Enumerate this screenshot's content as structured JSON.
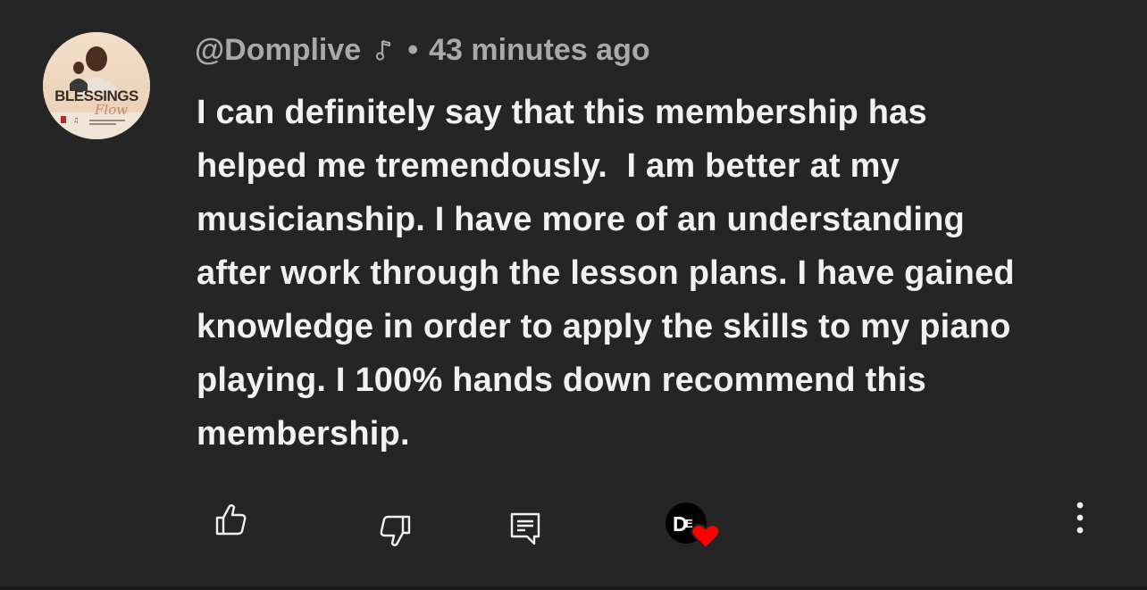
{
  "comment": {
    "author": "@Domplive",
    "separator": "•",
    "timestamp": "43 minutes ago",
    "text": "I can definitely say that this membership has\nhelped me tremendously.  I am better at my\nmusicianship. I have more of an understanding\nafter work through the lesson plans. I have gained\nknowledge in order to apply the skills to my piano\nplaying. I 100% hands down recommend this\nmembership.",
    "avatar": {
      "title": "BLESSINGS",
      "subtitle": "Flow"
    },
    "creator_badge_initials": "DE"
  },
  "icons": {
    "author_badge": "music-note-icon",
    "like": "thumbs-up-icon",
    "dislike": "thumbs-down-icon",
    "reply": "reply-comment-icon",
    "creator_heart": "creator-heart-icon",
    "more": "more-vertical-icon"
  },
  "colors": {
    "background": "#252525",
    "text_primary": "#f1f1f1",
    "text_secondary": "#a9a9a9",
    "heart": "#ff0000"
  }
}
